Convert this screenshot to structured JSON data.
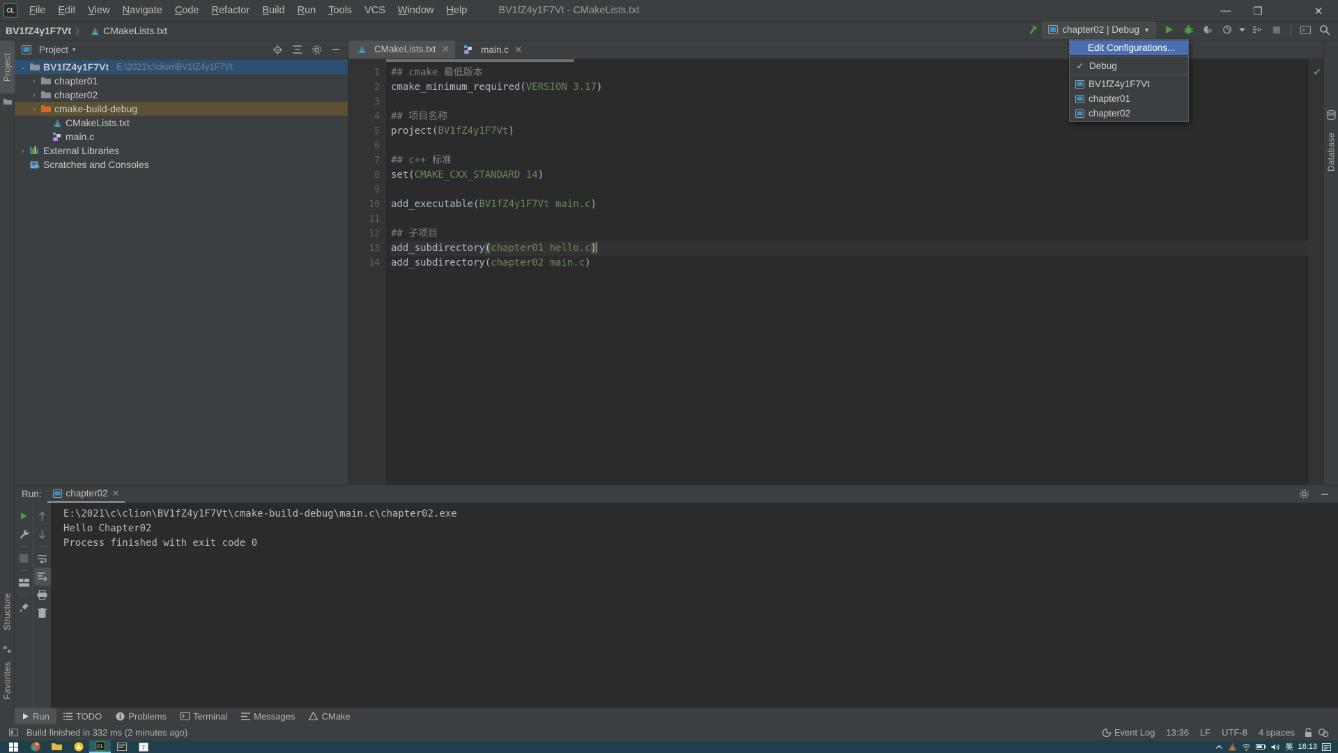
{
  "window": {
    "title": "BV1fZ4y1F7Vt - CMakeLists.txt",
    "minimize_label": "—",
    "maximize_label": "❐",
    "close_label": "✕"
  },
  "menubar": {
    "items": [
      {
        "label": "File",
        "mnemonic": "F"
      },
      {
        "label": "Edit",
        "mnemonic": "E"
      },
      {
        "label": "View",
        "mnemonic": "V"
      },
      {
        "label": "Navigate",
        "mnemonic": "N"
      },
      {
        "label": "Code",
        "mnemonic": "C"
      },
      {
        "label": "Refactor",
        "mnemonic": "R"
      },
      {
        "label": "Build",
        "mnemonic": "B"
      },
      {
        "label": "Run",
        "mnemonic": "R"
      },
      {
        "label": "Tools",
        "mnemonic": "T"
      },
      {
        "label": "VCS",
        "mnemonic": ""
      },
      {
        "label": "Window",
        "mnemonic": "W"
      },
      {
        "label": "Help",
        "mnemonic": "H"
      }
    ],
    "logo_text": "CL"
  },
  "navbar": {
    "project": "BV1fZ4y1F7Vt",
    "separator": "〉",
    "file": "CMakeLists.txt"
  },
  "toolbar": {
    "run_config_label": "chapter02 | Debug",
    "chevron": "▼",
    "icons": [
      "hammer-build-icon",
      "run-icon",
      "debug-icon",
      "run-with-coverage-icon",
      "profile-icon",
      "profile-dropdown-icon",
      "attach-debugger-icon",
      "stop-icon",
      "terminal-icon",
      "search-everywhere-icon"
    ]
  },
  "run_config_popup": {
    "edit_configurations": "Edit Configurations...",
    "debug_entry": "Debug",
    "check_glyph": "✓",
    "configurations": [
      "BV1fZ4y1F7Vt",
      "chapter01",
      "chapter02"
    ]
  },
  "left_strip": {
    "project_tab": "Project",
    "structure_tab": "Structure",
    "favorites_tab": "Favorites"
  },
  "right_strip": {
    "database_tab": "Database"
  },
  "project_panel": {
    "title": "Project",
    "title_chevron": "▾",
    "header_icons": [
      "locate-icon",
      "collapse-all-icon",
      "settings-icon",
      "hide-icon"
    ],
    "tree": [
      {
        "label": "BV1fZ4y1F7Vt",
        "path": "E:\\2021\\c\\clion\\BV1fZ4y1F7Vt",
        "icon": "folder-icon",
        "arrow": "⌄",
        "indent": 0,
        "state": "selected-root",
        "bold": true
      },
      {
        "label": "chapter01",
        "path": "",
        "icon": "folder-icon",
        "arrow": "›",
        "indent": 1,
        "state": "",
        "bold": false
      },
      {
        "label": "chapter02",
        "path": "",
        "icon": "folder-icon",
        "arrow": "›",
        "indent": 1,
        "state": "",
        "bold": false
      },
      {
        "label": "cmake-build-debug",
        "path": "",
        "icon": "folder-excluded-icon",
        "arrow": "›",
        "indent": 1,
        "state": "selected-file",
        "bold": false
      },
      {
        "label": "CMakeLists.txt",
        "path": "",
        "icon": "cmake-file-icon",
        "arrow": "",
        "indent": 2,
        "state": "",
        "bold": false
      },
      {
        "label": "main.c",
        "path": "",
        "icon": "c-file-icon",
        "arrow": "",
        "indent": 2,
        "state": "",
        "bold": false
      },
      {
        "label": "External Libraries",
        "path": "",
        "icon": "libraries-icon",
        "arrow": "›",
        "indent": 0,
        "state": "",
        "bold": false
      },
      {
        "label": "Scratches and Consoles",
        "path": "",
        "icon": "scratches-icon",
        "arrow": "",
        "indent": 0,
        "state": "",
        "bold": false
      }
    ]
  },
  "editor": {
    "tabs": [
      {
        "label": "CMakeLists.txt",
        "icon": "cmake-file-icon",
        "active": true,
        "close": "✕"
      },
      {
        "label": "main.c",
        "icon": "c-file-icon",
        "active": false,
        "close": "✕"
      }
    ],
    "line_numbers": [
      1,
      2,
      3,
      4,
      5,
      6,
      7,
      8,
      9,
      10,
      11,
      12,
      13,
      14
    ],
    "lines": [
      {
        "n": 1,
        "current": false,
        "parts": [
          {
            "t": "## cmake 最低版本",
            "c": "tok-comment"
          }
        ]
      },
      {
        "n": 2,
        "current": false,
        "parts": [
          {
            "t": "cmake_minimum_required(",
            "c": "tok-fn"
          },
          {
            "t": "VERSION 3.17",
            "c": "tok-arg"
          },
          {
            "t": ")",
            "c": "tok-fn"
          }
        ]
      },
      {
        "n": 3,
        "current": false,
        "parts": []
      },
      {
        "n": 4,
        "current": false,
        "parts": [
          {
            "t": "## 项目名称",
            "c": "tok-comment"
          }
        ]
      },
      {
        "n": 5,
        "current": false,
        "parts": [
          {
            "t": "project(",
            "c": "tok-fn"
          },
          {
            "t": "BV1fZ4y1F7Vt",
            "c": "tok-arg"
          },
          {
            "t": ")",
            "c": "tok-fn"
          }
        ]
      },
      {
        "n": 6,
        "current": false,
        "parts": []
      },
      {
        "n": 7,
        "current": false,
        "parts": [
          {
            "t": "## c++ 标准",
            "c": "tok-comment"
          }
        ]
      },
      {
        "n": 8,
        "current": false,
        "parts": [
          {
            "t": "set(",
            "c": "tok-fn"
          },
          {
            "t": "CMAKE_CXX_STANDARD 14",
            "c": "tok-arg"
          },
          {
            "t": ")",
            "c": "tok-fn"
          }
        ]
      },
      {
        "n": 9,
        "current": false,
        "parts": []
      },
      {
        "n": 10,
        "current": false,
        "parts": [
          {
            "t": "add_executable(",
            "c": "tok-fn"
          },
          {
            "t": "BV1fZ4y1F7Vt main.c",
            "c": "tok-arg"
          },
          {
            "t": ")",
            "c": "tok-fn"
          }
        ]
      },
      {
        "n": 11,
        "current": false,
        "parts": []
      },
      {
        "n": 12,
        "current": false,
        "parts": [
          {
            "t": "## 子项目",
            "c": "tok-comment"
          }
        ]
      },
      {
        "n": 13,
        "current": true,
        "parts": [
          {
            "t": "add_subdirectory",
            "c": "tok-fn"
          },
          {
            "t": "(",
            "c": "tok-paren-hl"
          },
          {
            "t": "chapter01 hello.c",
            "c": "tok-arg"
          },
          {
            "t": ")",
            "c": "tok-paren-hl"
          }
        ]
      },
      {
        "n": 14,
        "current": false,
        "parts": [
          {
            "t": "add_subdirectory(",
            "c": "tok-fn"
          },
          {
            "t": "chapter02 main.c",
            "c": "tok-arg"
          },
          {
            "t": ")",
            "c": "tok-fn"
          }
        ]
      }
    ],
    "inspection_glyph": "✔"
  },
  "run_panel": {
    "label": "Run:",
    "tab_label": "chapter02",
    "tab_close": "✕",
    "header_icons": [
      "settings-icon",
      "hide-icon"
    ],
    "gutter_icons": [
      "rerun-icon",
      "wrench-icon",
      "stop-icon",
      "layout-icon",
      "pin-icon"
    ],
    "gutter2_icons": [
      "up-icon",
      "down-icon",
      "soft-wrap-icon",
      "scroll-to-end-icon",
      "print-icon",
      "clear-all-icon"
    ],
    "console_lines": [
      "E:\\2021\\c\\clion\\BV1fZ4y1F7Vt\\cmake-build-debug\\main.c\\chapter02.exe",
      "Hello Chapter02",
      "Process finished with exit code 0"
    ]
  },
  "bottom_tabs": [
    {
      "label": "Run",
      "icon": "run-icon",
      "active": true
    },
    {
      "label": "TODO",
      "icon": "todo-icon",
      "active": false
    },
    {
      "label": "Problems",
      "icon": "problems-icon",
      "active": false
    },
    {
      "label": "Terminal",
      "icon": "terminal-icon",
      "active": false
    },
    {
      "label": "Messages",
      "icon": "messages-icon",
      "active": false
    },
    {
      "label": "CMake",
      "icon": "cmake-icon",
      "active": false
    }
  ],
  "statusbar": {
    "build_message": "Build finished in 332 ms (2 minutes ago)",
    "event_log": "Event Log",
    "caret_position": "13:36",
    "line_separator": "LF",
    "encoding": "UTF-8",
    "indent": "4 spaces",
    "icons": [
      "memory-icon",
      "event-log-icon",
      "lock-icon",
      "inspection-profile-icon"
    ]
  },
  "taskbar": {
    "apps": [
      "windows-start-icon",
      "chrome-icon",
      "explorer-icon",
      "browser-icon",
      "clion-icon",
      "snip-icon",
      "typora-icon"
    ],
    "tray_icons": [
      "chevron-up-icon",
      "app-tray-icon",
      "network-icon",
      "battery-icon",
      "volume-icon",
      "ime-icon"
    ],
    "clock": "16:13",
    "notification_icon": "notifications-icon"
  },
  "colors": {
    "ui_bg": "#3c3f41",
    "editor_bg": "#2b2b2b",
    "accent_blue": "#4b6eaf",
    "selection_root": "#2d4f74",
    "selection_file": "#5c5233",
    "green": "#4e9a45",
    "string_green": "#6a8759",
    "comment_gray": "#808080",
    "taskbar": "#1f3f4b"
  }
}
